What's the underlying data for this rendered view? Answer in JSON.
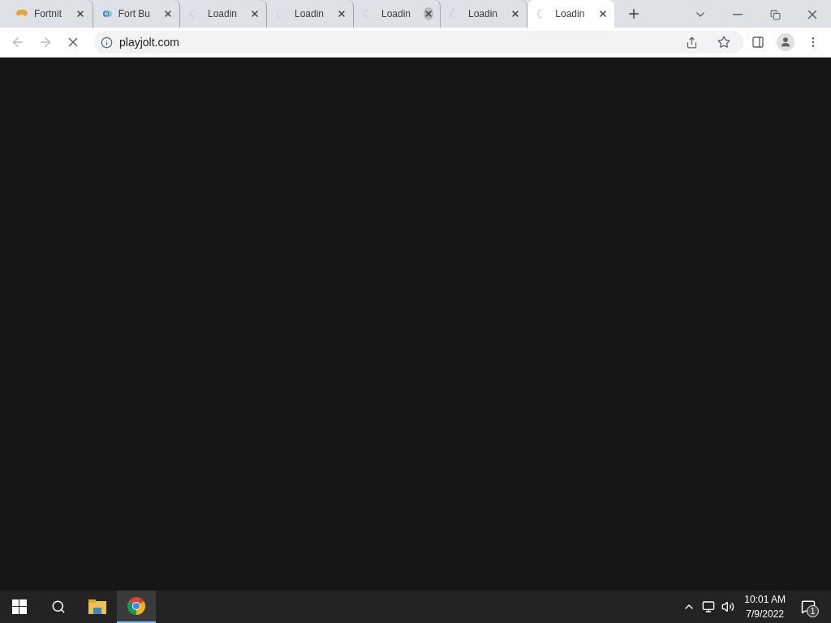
{
  "tabs": [
    {
      "label": "Fortnit",
      "kind": "page",
      "selected": false,
      "hovered": false
    },
    {
      "label": "Fort Bu",
      "kind": "page",
      "selected": false,
      "hovered": false
    },
    {
      "label": "Loadin",
      "kind": "loading",
      "selected": false,
      "hovered": false
    },
    {
      "label": "Loadin",
      "kind": "loading",
      "selected": false,
      "hovered": false
    },
    {
      "label": "Loadin",
      "kind": "loading",
      "selected": false,
      "hovered": true
    },
    {
      "label": "Loadin",
      "kind": "loading",
      "selected": false,
      "hovered": false
    },
    {
      "label": "Loadin",
      "kind": "loading",
      "selected": true,
      "hovered": false
    }
  ],
  "address_bar": {
    "url": "playjolt.com"
  },
  "taskbar": {
    "time": "10:01 AM",
    "date": "7/9/2022",
    "notification_count": "1"
  }
}
